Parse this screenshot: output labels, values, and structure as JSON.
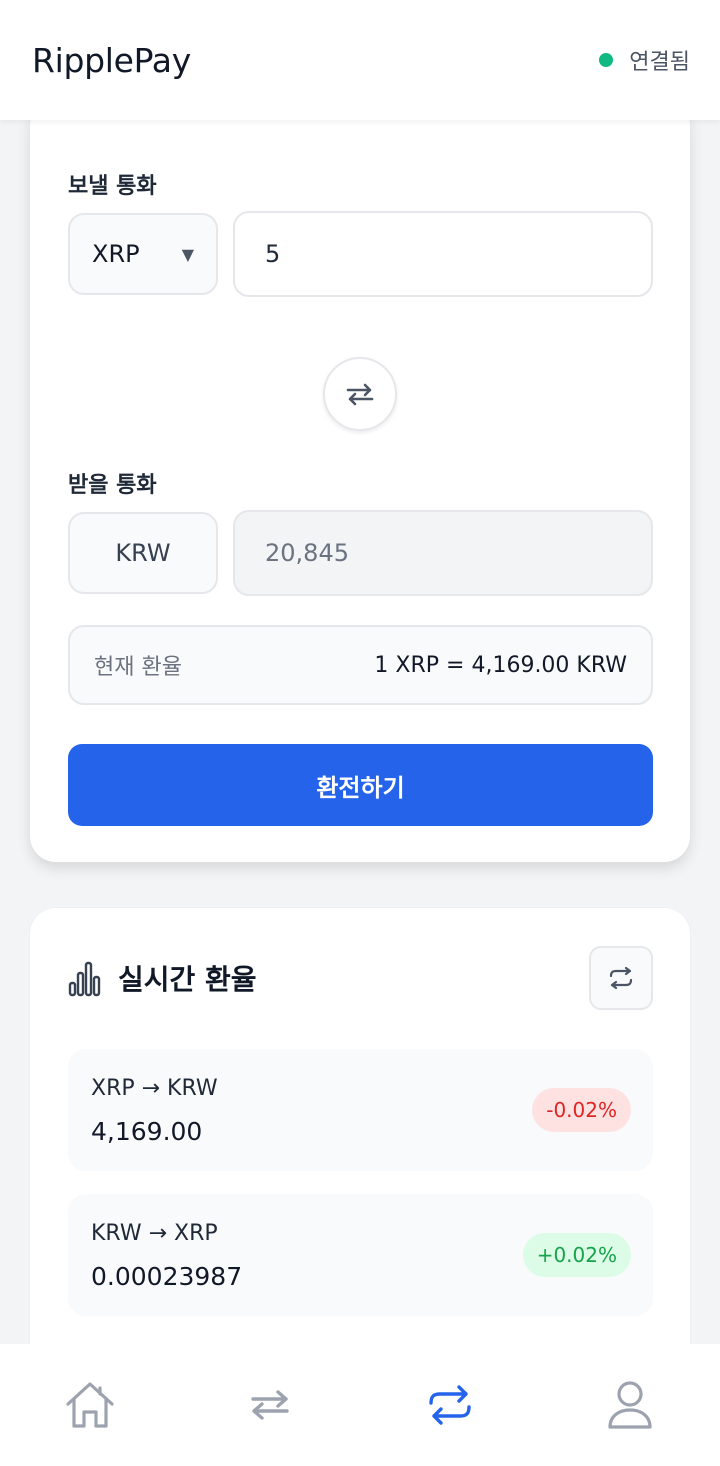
{
  "header": {
    "title": "RipplePay",
    "status_text": "연결됨",
    "status_color": "#10b981"
  },
  "convert": {
    "send_label": "보낼 통화",
    "send_currency": "XRP",
    "send_amount": "5",
    "swap_icon": "swap-horizontal-icon",
    "receive_label": "받을 통화",
    "receive_currency": "KRW",
    "receive_amount": "20,845",
    "rate_label": "현재 환율",
    "rate_value": "1 XRP = 4,169.00 KRW",
    "button_label": "환전하기",
    "accent_color": "#2563eb"
  },
  "rates": {
    "title": "실시간 환율",
    "title_icon": "bar-chart-icon",
    "refresh_icon": "refresh-icon",
    "items": [
      {
        "pair": "XRP → KRW",
        "value": "4,169.00",
        "change": "-0.02%",
        "direction": "down"
      },
      {
        "pair": "KRW → XRP",
        "value": "0.00023987",
        "change": "+0.02%",
        "direction": "up"
      }
    ]
  },
  "nav": {
    "items": [
      {
        "icon": "home-icon",
        "active": false
      },
      {
        "icon": "transfer-icon",
        "active": false
      },
      {
        "icon": "exchange-icon",
        "active": true
      },
      {
        "icon": "profile-icon",
        "active": false
      }
    ],
    "active_color": "#2563eb",
    "inactive_color": "#9ca3af"
  }
}
